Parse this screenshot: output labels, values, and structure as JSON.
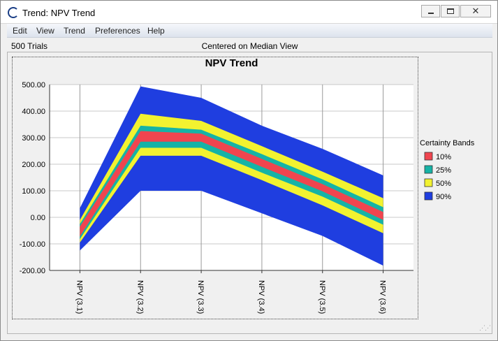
{
  "window": {
    "title": "Trend: NPV Trend",
    "icon": "crystal-ball-icon",
    "controls": {
      "minimize": "minimize-icon",
      "maximize": "maximize-icon",
      "close": "✕"
    }
  },
  "menu": [
    "Edit",
    "View",
    "Trend",
    "Preferences",
    "Help"
  ],
  "status": {
    "trials": "500 Trials",
    "view": "Centered on Median View"
  },
  "chart_data": {
    "type": "area",
    "title": "NPV Trend",
    "categories": [
      "NPV (3.1)",
      "NPV (3.2)",
      "NPV (3.3)",
      "NPV (3.4)",
      "NPV (3.5)",
      "NPV (3.6)"
    ],
    "ylim": [
      -200,
      500
    ],
    "yticks": [
      500,
      400,
      300,
      200,
      100,
      0,
      -100,
      -200
    ],
    "ytick_labels": [
      "500.00",
      "400.00",
      "300.00",
      "200.00",
      "100.00",
      "0.00",
      "-100.00",
      "-200.00"
    ],
    "grid": true,
    "legend_title": "Certainty Bands",
    "legend_position": "right",
    "series": [
      {
        "name": "90%",
        "color": "#1f3ee0",
        "lower": [
          -125,
          100,
          100,
          15,
          -70,
          -182
        ],
        "upper": [
          35,
          493,
          450,
          345,
          258,
          158
        ]
      },
      {
        "name": "50%",
        "color": "#f2f230",
        "lower": [
          -95,
          232,
          232,
          140,
          45,
          -60
        ],
        "upper": [
          -10,
          390,
          363,
          268,
          172,
          72
        ]
      },
      {
        "name": "25%",
        "color": "#16b3a6",
        "lower": [
          -82,
          262,
          262,
          168,
          78,
          -28
        ],
        "upper": [
          -25,
          345,
          330,
          238,
          143,
          38
        ]
      },
      {
        "name": "10%",
        "color": "#f0454f",
        "lower": [
          -72,
          285,
          285,
          190,
          98,
          -10
        ],
        "upper": [
          -35,
          325,
          315,
          220,
          125,
          20
        ]
      }
    ]
  }
}
